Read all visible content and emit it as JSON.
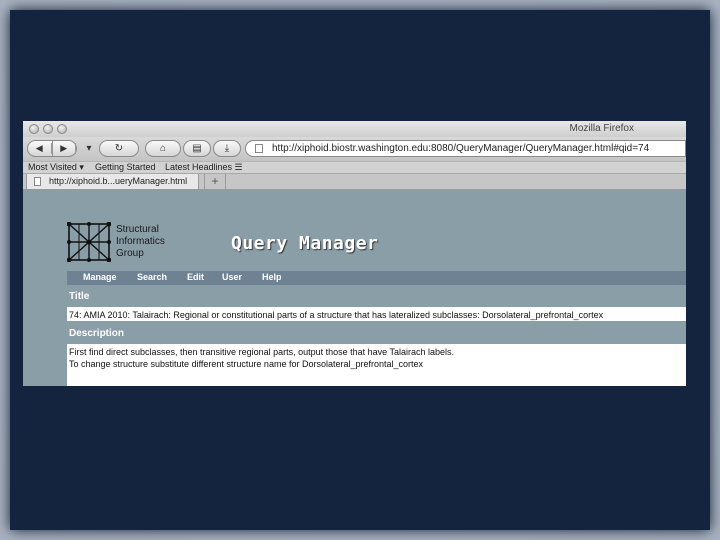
{
  "window": {
    "title": "Mozilla Firefox"
  },
  "toolbar": {
    "back_glyph": "◀",
    "forward_glyph": "▶",
    "dropdown_glyph": "▾",
    "reload_glyph": "↻",
    "home_glyph": "⌂",
    "print_glyph": "▤",
    "download_glyph": "⤓",
    "url": "http://xiphoid.biostr.washington.edu:8080/QueryManager/QueryManager.html#qid=74"
  },
  "bookmarks": {
    "items": [
      {
        "label": "Most Visited ▾"
      },
      {
        "label": "Getting Started"
      },
      {
        "label": "Latest Headlines ☰"
      }
    ]
  },
  "tabs": {
    "active_label": "http://xiphoid.b...ueryManager.html",
    "new_tab_glyph": "+"
  },
  "logo": {
    "line1": "Structural",
    "line2": "Informatics",
    "line3": "Group"
  },
  "page": {
    "heading": "Query Manager",
    "menu": [
      {
        "label": "Manage"
      },
      {
        "label": "Search"
      },
      {
        "label": "Edit"
      },
      {
        "label": "User"
      },
      {
        "label": "Help"
      }
    ],
    "title_label": "Title",
    "title_value": "74: AMIA 2010: Talairach: Regional or constitutional parts of a structure that has lateralized subclasses: Dorsolateral_prefrontal_cortex",
    "description_label": "Description",
    "description_lines": [
      "First find direct subclasses, then transitive regional parts, output those that have Talairach labels.",
      "To change structure substitute different structure name for Dorsolateral_prefrontal_cortex"
    ]
  }
}
